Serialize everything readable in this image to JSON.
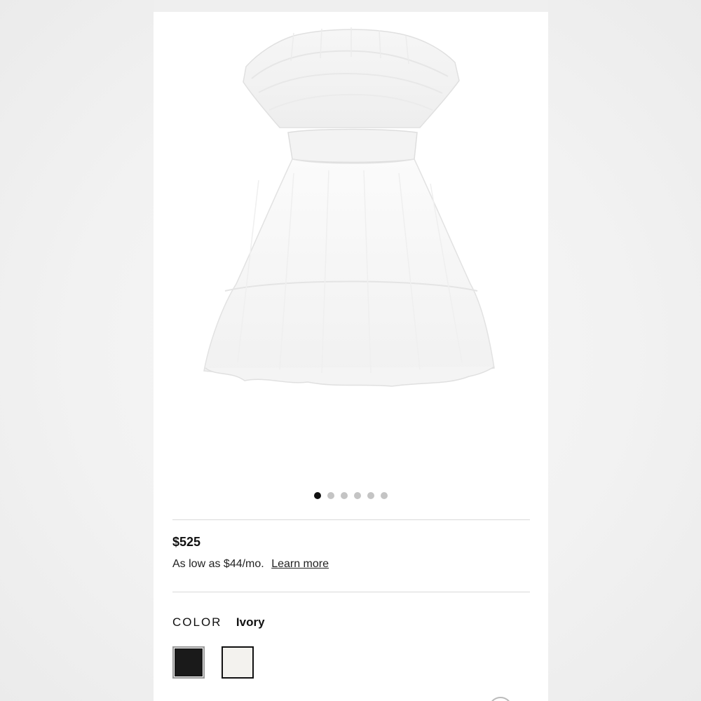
{
  "product": {
    "image_alt": "Ivory strapless tulle ruffle mini dress",
    "image_count": 6,
    "active_image_index": 0
  },
  "pricing": {
    "price": "$525",
    "installment_text": "As low as $44/mo.",
    "learn_more_label": "Learn more"
  },
  "color": {
    "label": "COLOR",
    "selected": "Ivory",
    "swatches": [
      {
        "name": "Black",
        "hex": "#1a1a1a"
      },
      {
        "name": "Ivory",
        "hex": "#f3f2ee"
      }
    ]
  }
}
